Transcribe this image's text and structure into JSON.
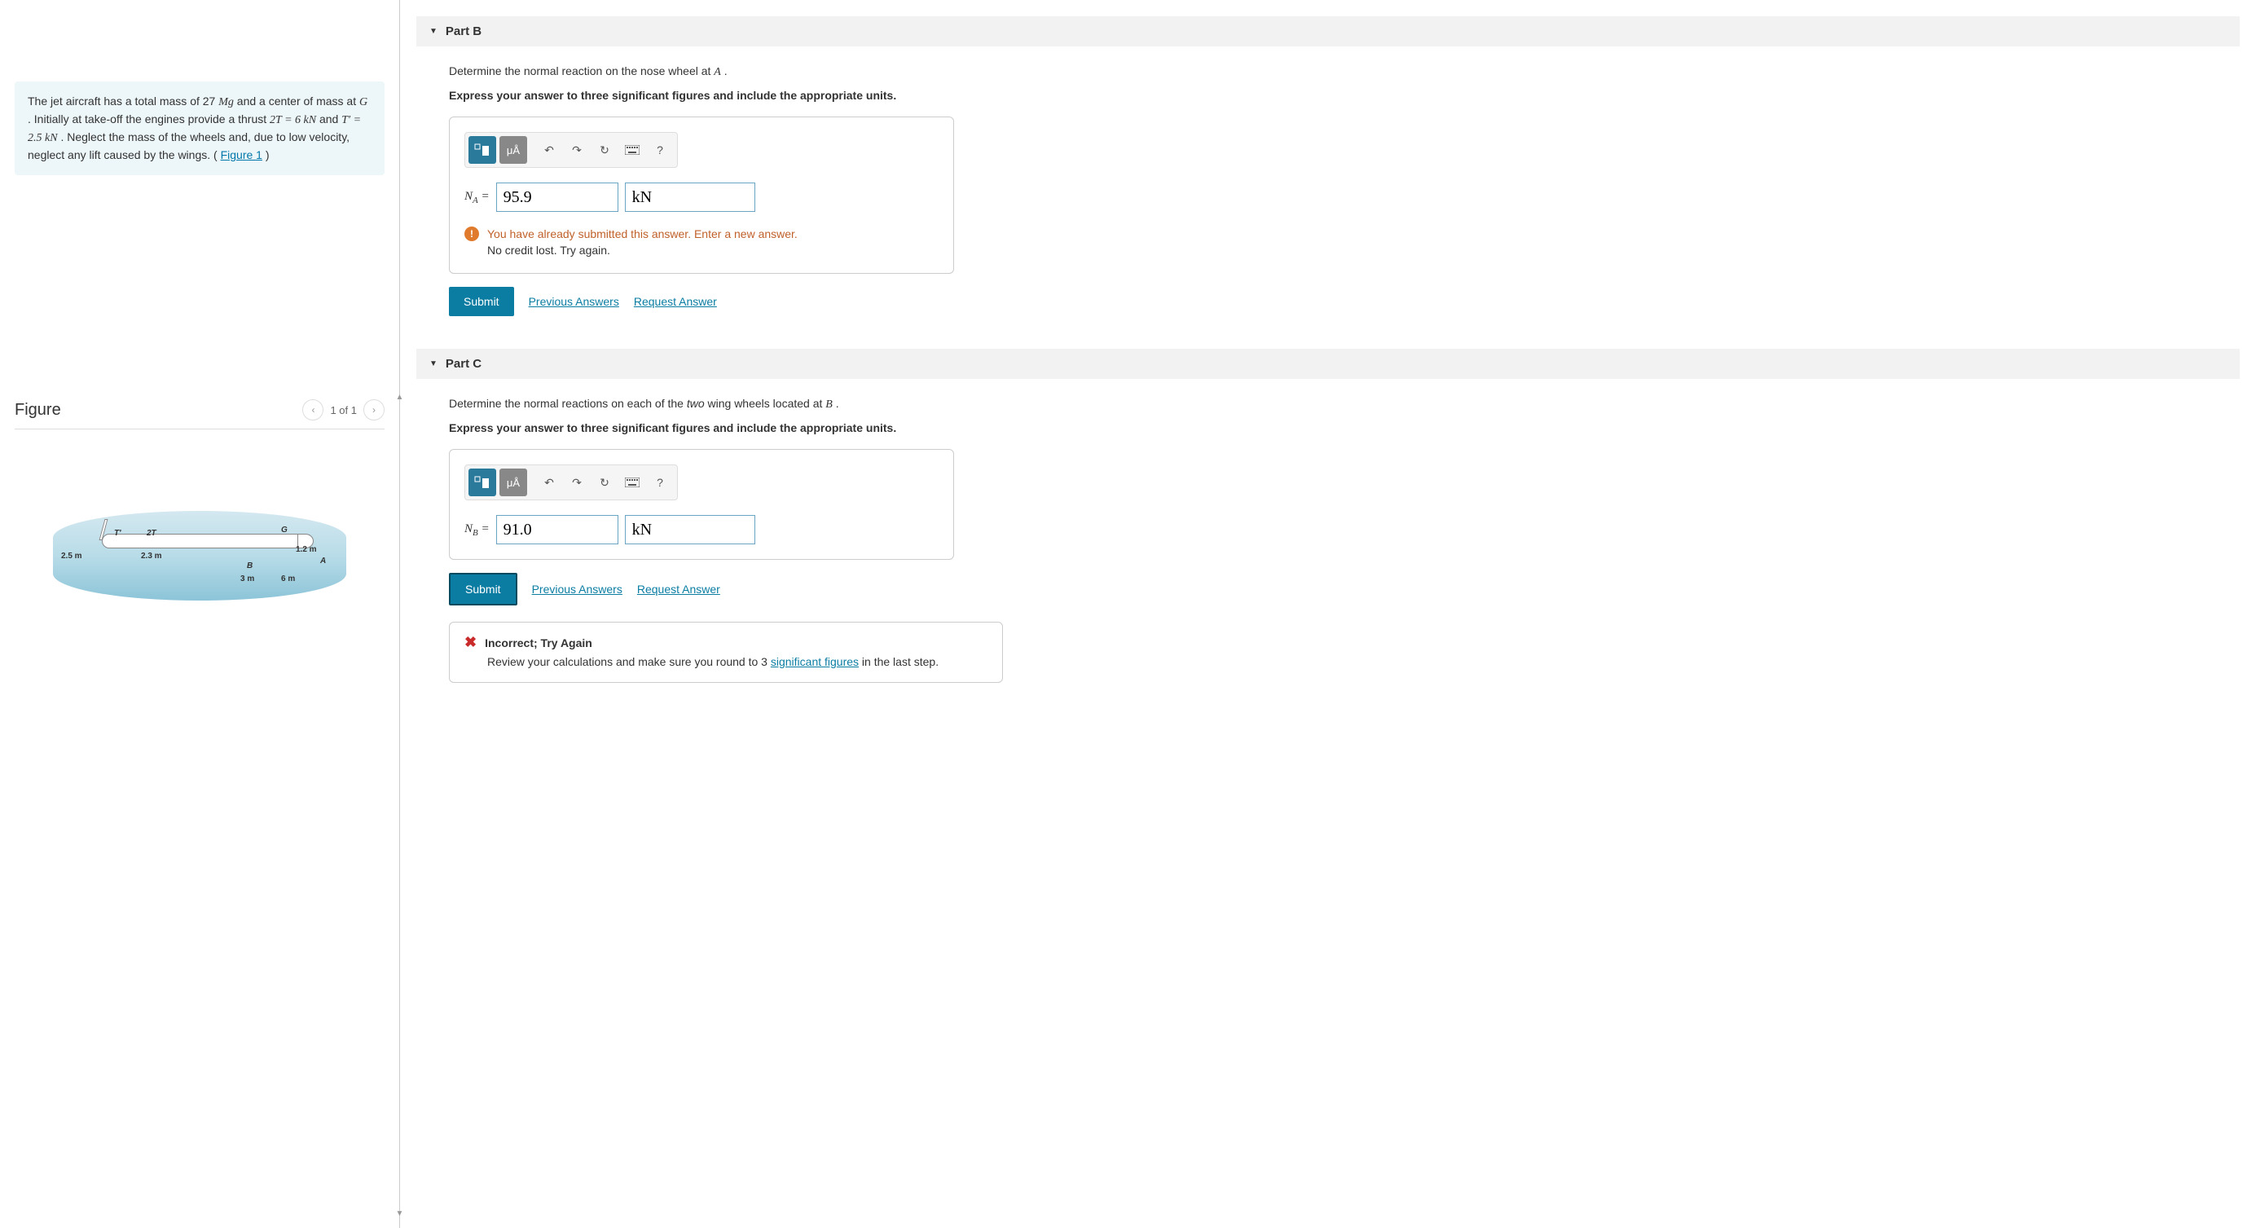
{
  "problem": {
    "text_pre": "The jet aircraft has a total mass of 27 ",
    "mass_unit": "Mg",
    "text_mid1": " and a center of mass at ",
    "var_G": "G",
    "text_mid2": ". Initially at take-off the engines provide a thrust ",
    "thrust1": "2T = 6  kN",
    "text_mid3": " and ",
    "thrust2": "T′ = 2.5  kN",
    "text_mid4": " . Neglect the mass of the wheels and, due to low velocity, neglect any lift caused by the wings. (",
    "figure_link": "Figure 1",
    "text_end": ")"
  },
  "figure": {
    "title": "Figure",
    "counter": "1 of 1",
    "labels": {
      "T_prime": "T′",
      "two_T": "2T",
      "G": "G",
      "B": "B",
      "A": "A",
      "d_2_5m": "2.5 m",
      "d_2_3m": "2.3 m",
      "d_1_2m": "1.2 m",
      "d_3m": "3 m",
      "d_6m": "6 m"
    }
  },
  "partB": {
    "title": "Part B",
    "question_pre": "Determine the normal reaction on the nose wheel at ",
    "question_var": "A",
    "question_post": ".",
    "instruction": "Express your answer to three significant figures and include the appropriate units.",
    "toolbar": {
      "units_label": "μÅ",
      "help": "?"
    },
    "label_var": "N",
    "label_sub": "A",
    "equals": " = ",
    "value": "95.9",
    "units": "kN",
    "feedback_line1": "You have already submitted this answer. Enter a new answer.",
    "feedback_line2": "No credit lost. Try again.",
    "submit": "Submit",
    "prev_answers": "Previous Answers",
    "request_answer": "Request Answer"
  },
  "partC": {
    "title": "Part C",
    "question_pre": "Determine the normal reactions on each of the ",
    "question_em": "two",
    "question_mid": " wing wheels located at ",
    "question_var": "B",
    "question_post": ".",
    "instruction": "Express your answer to three significant figures and include the appropriate units.",
    "toolbar": {
      "units_label": "μÅ",
      "help": "?"
    },
    "label_var": "N",
    "label_sub": "B",
    "equals": " = ",
    "value": "91.0",
    "units": "kN",
    "submit": "Submit",
    "prev_answers": "Previous Answers",
    "request_answer": "Request Answer",
    "incorrect_title": "Incorrect; Try Again",
    "incorrect_body_pre": "Review your calculations and make sure you round to 3 ",
    "incorrect_link": "significant figures",
    "incorrect_body_post": " in the last step."
  }
}
